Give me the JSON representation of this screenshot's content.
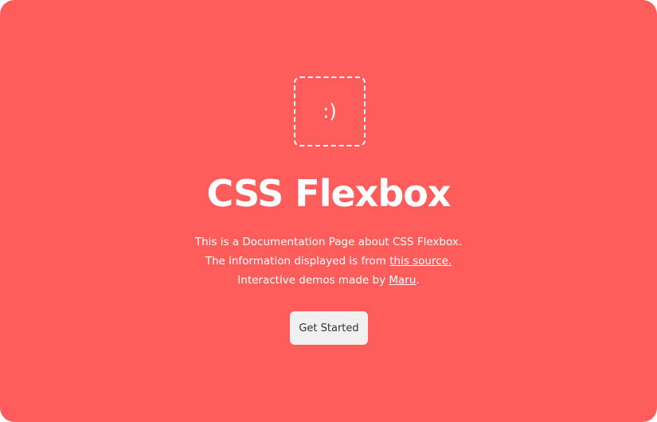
{
  "logo": {
    "text": ":)"
  },
  "hero": {
    "title": "CSS Flexbox",
    "line1": "This is a Documentation Page about CSS Flexbox.",
    "line2_prefix": "The information displayed is from ",
    "line2_link": "this source.",
    "line3_prefix": "Interactive demos made by ",
    "line3_link": "Maru",
    "line3_suffix": "."
  },
  "cta": {
    "label": "Get Started"
  },
  "colors": {
    "background": "#ff5c5c",
    "button_bg": "#f0f0f0",
    "text": "#ffffff"
  }
}
